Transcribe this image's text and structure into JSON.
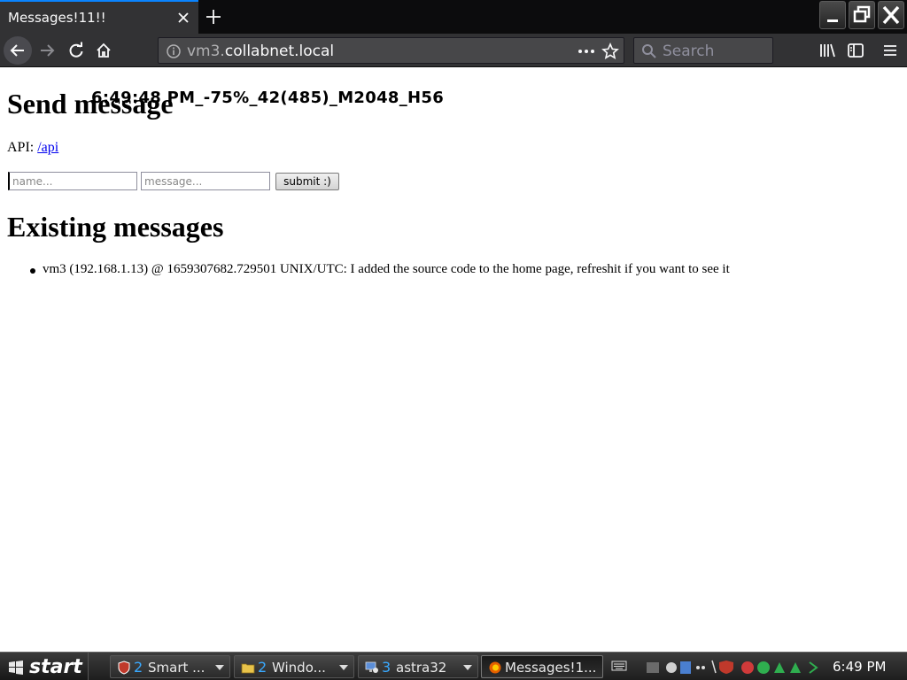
{
  "browser": {
    "tab_title": "Messages!11!!",
    "url_scheme_host_prefix": "vm3.",
    "url_host": "collabnet.local",
    "search_placeholder": "Search"
  },
  "page": {
    "overlay_stamp": "6:49:48 PM_-75%_42(485)_M2048_H56",
    "send_heading": "Send message",
    "api_label": "API:",
    "api_link": "/api",
    "name_placeholder": "name...",
    "message_placeholder": "message...",
    "submit_label": "submit :)",
    "existing_heading": "Existing messages",
    "messages": [
      "vm3 (192.168.1.13) @ 1659307682.729501 UNIX/UTC: I added the source code to the home page, refreshit if you want to see it"
    ]
  },
  "taskbar": {
    "start_label": "start",
    "tasks": [
      {
        "count": "2",
        "label": "Smart ...",
        "icon": "shield-icon"
      },
      {
        "count": "2",
        "label": "Windo...",
        "icon": "folder-icon"
      },
      {
        "count": "3",
        "label": "astra32",
        "icon": "computer-icon"
      },
      {
        "count": "",
        "label": "Messages!1...",
        "icon": "firefox-icon"
      }
    ],
    "clock": "6:49 PM"
  },
  "colors": {
    "tab_accent": "#0a84ff",
    "chrome_dark": "#323234",
    "link": "#0000ee",
    "taskbar_count": "#39a9ff"
  }
}
